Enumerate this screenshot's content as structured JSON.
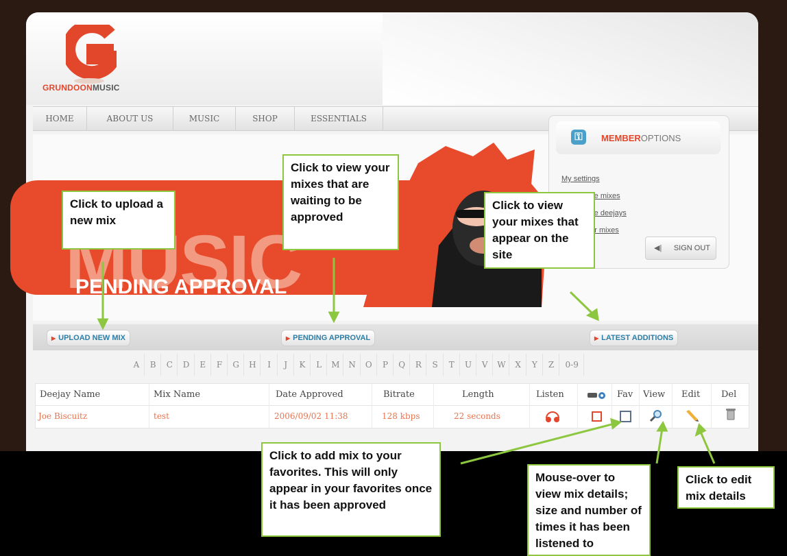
{
  "logo": {
    "part1": "GRUNDOON",
    "part2": "MUSIC"
  },
  "nav": [
    "HOME",
    "ABOUT US",
    "MUSIC",
    "SHOP",
    "ESSENTIALS"
  ],
  "banner": {
    "big_word": "MUSIC",
    "subtitle": "PENDING APPROVAL"
  },
  "member": {
    "title_part1": "MEMBER",
    "title_part2": "OPTIONS",
    "links": [
      "My settings",
      "My favorite mixes",
      "My favorite deejays",
      "Administer mixes"
    ],
    "signout": "SIGN OUT"
  },
  "tabs": {
    "upload": "UPLOAD NEW MIX",
    "pending": "PENDING APPROVAL",
    "latest": "LATEST ADDITIONS"
  },
  "alphabet": [
    "A",
    "B",
    "C",
    "D",
    "E",
    "F",
    "G",
    "H",
    "I",
    "J",
    "K",
    "L",
    "M",
    "N",
    "O",
    "P",
    "Q",
    "R",
    "S",
    "T",
    "U",
    "V",
    "W",
    "X",
    "Y",
    "Z",
    "0-9"
  ],
  "table": {
    "headers": [
      "Deejay Name",
      "Mix Name",
      "Date Approved",
      "Bitrate",
      "Length",
      "Listen",
      "",
      "Fav",
      "View",
      "Edit",
      "Del"
    ],
    "row": {
      "deejay": "Joe Biscuitz",
      "mix": "test",
      "date": "2006/09/02 11:38",
      "bitrate": "128 kbps",
      "length": "22 seconds"
    }
  },
  "callouts": {
    "upload": "Click  to upload a new mix",
    "pending": "Click to view your mixes that are waiting to be approved",
    "latest": "Click  to view your mixes that appear on the site",
    "fav": "Click to add mix to your favorites. This will only appear in your favorites once it has been approved",
    "view": "Mouse-over to view mix details; size and number of times it has been listened to",
    "edit": "Click  to edit mix details"
  },
  "colors": {
    "brand_red": "#e2462b",
    "callout_border": "#8dc63f",
    "link_blue": "#2d7ea6"
  }
}
